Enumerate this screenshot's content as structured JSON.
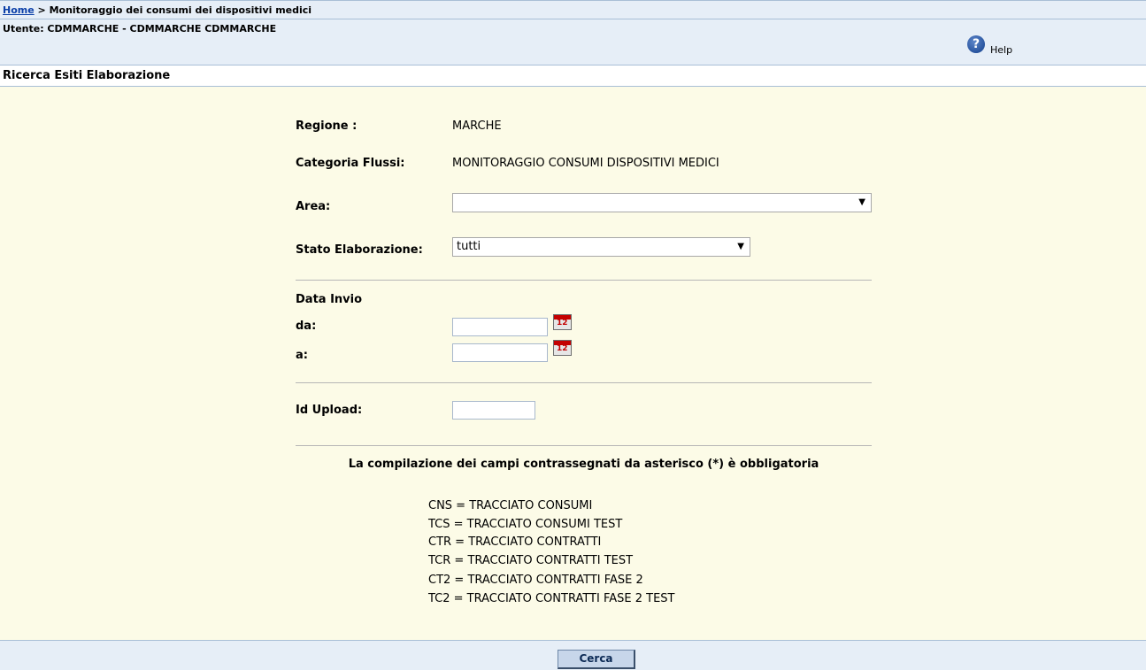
{
  "breadcrumb": {
    "home_link": "Home",
    "separator": " > ",
    "current": "Monitoraggio dei consumi dei dispositivi medici"
  },
  "user_bar": {
    "user_text": "Utente: CDMMARCHE - CDMMARCHE CDMMARCHE",
    "help_label": "Help",
    "help_icon_glyph": "?"
  },
  "section_title": "Ricerca Esiti Elaborazione",
  "form": {
    "regione": {
      "label": "Regione :",
      "value": "MARCHE"
    },
    "categoria": {
      "label": "Categoria Flussi:",
      "value": "MONITORAGGIO CONSUMI DISPOSITIVI MEDICI"
    },
    "area": {
      "label": "Area:",
      "value": ""
    },
    "stato": {
      "label": "Stato Elaborazione:",
      "value": "tutti"
    },
    "data_invio": {
      "label": "Data Invio",
      "da_label": "da:",
      "a_label": "a:",
      "da_value": "",
      "a_value": ""
    },
    "id_upload": {
      "label": "Id Upload:",
      "value": ""
    },
    "note": "La compilazione dei campi contrassegnati da asterisco (*) è obbligatoria",
    "legend": [
      "CNS = TRACCIATO CONSUMI",
      "TCS = TRACCIATO CONSUMI TEST",
      "CTR = TRACCIATO CONTRATTI",
      "TCR = TRACCIATO CONTRATTI TEST",
      "CT2 = TRACCIATO CONTRATTI FASE 2",
      "TC2 = TRACCIATO CONTRATTI FASE 2 TEST"
    ]
  },
  "footer": {
    "search_button": "Cerca"
  },
  "icons": {
    "calendar": "calendar-icon",
    "dropdown": "chevron-down-icon",
    "help": "help-icon"
  },
  "colors": {
    "header_bg": "#e6eef7",
    "form_bg": "#fcfbe7",
    "link": "#0b3fa8"
  }
}
